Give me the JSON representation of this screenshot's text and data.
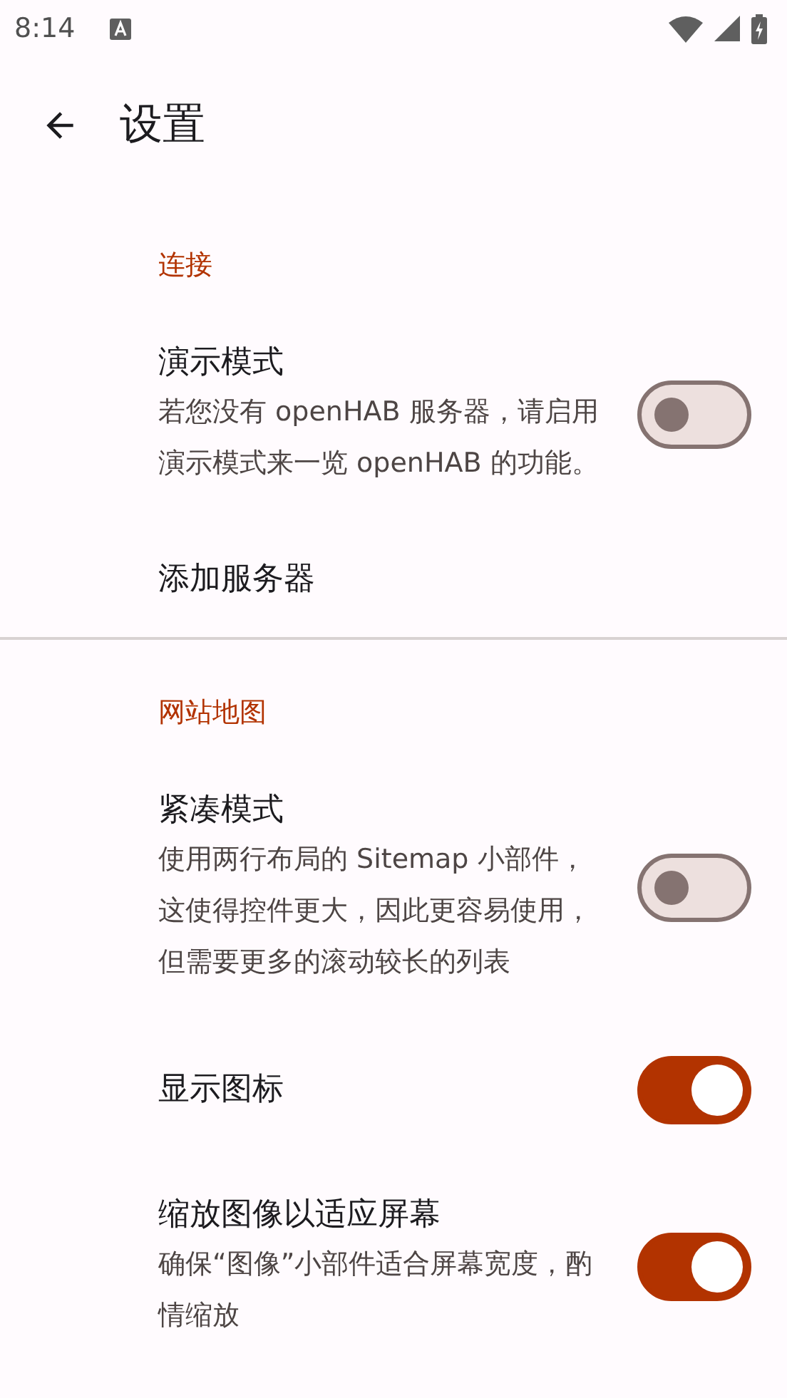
{
  "status_bar": {
    "time": "8:14"
  },
  "toolbar": {
    "title": "设置"
  },
  "sections": [
    {
      "header": "连接",
      "items": [
        {
          "kind": "switch",
          "title": "演示模式",
          "summary": "若您没有 openHAB 服务器，请启用演示模式来一览 openHAB 的功能。",
          "on": false
        },
        {
          "kind": "plain",
          "title": "添加服务器"
        }
      ]
    },
    {
      "header": "网站地图",
      "items": [
        {
          "kind": "switch",
          "title": "紧凑模式",
          "summary": "使用两行布局的 Sitemap 小部件，这使得控件更大，因此更容易使用，但需要更多的滚动较长的列表",
          "on": false
        },
        {
          "kind": "switch",
          "title": "显示图标",
          "on": true
        },
        {
          "kind": "switch",
          "title": "缩放图像以适应屏幕",
          "summary": "确保“图像”小部件适合屏幕宽度，酌情缩放",
          "on": true
        }
      ]
    }
  ]
}
